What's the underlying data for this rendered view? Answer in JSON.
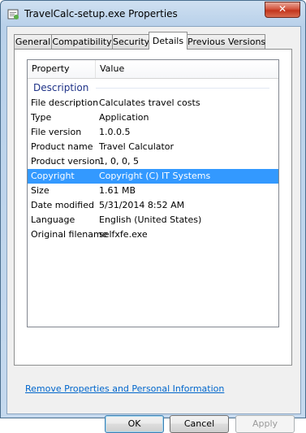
{
  "window": {
    "title": "TravelCalc-setup.exe Properties",
    "close_label": "✕"
  },
  "tabs": [
    {
      "label": "General"
    },
    {
      "label": "Compatibility"
    },
    {
      "label": "Security"
    },
    {
      "label": "Details"
    },
    {
      "label": "Previous Versions"
    }
  ],
  "active_tab": "Details",
  "list": {
    "col_property": "Property",
    "col_value": "Value",
    "group": "Description",
    "rows": [
      {
        "property": "File description",
        "value": "Calculates travel costs"
      },
      {
        "property": "Type",
        "value": "Application"
      },
      {
        "property": "File version",
        "value": "1.0.0.5"
      },
      {
        "property": "Product name",
        "value": "Travel Calculator"
      },
      {
        "property": "Product version",
        "value": "1, 0, 0, 5"
      },
      {
        "property": "Copyright",
        "value": "Copyright (C) IT Systems"
      },
      {
        "property": "Size",
        "value": "1.61 MB"
      },
      {
        "property": "Date modified",
        "value": "5/31/2014 8:52 AM"
      },
      {
        "property": "Language",
        "value": "English (United States)"
      },
      {
        "property": "Original filename",
        "value": "selfxfe.exe"
      }
    ],
    "selected_row": "Copyright"
  },
  "link": "Remove Properties and Personal Information",
  "buttons": {
    "ok": "OK",
    "cancel": "Cancel",
    "apply": "Apply"
  },
  "colors": {
    "selection": "#3399ff",
    "link": "#0066cc",
    "group_header": "#1e3287"
  }
}
